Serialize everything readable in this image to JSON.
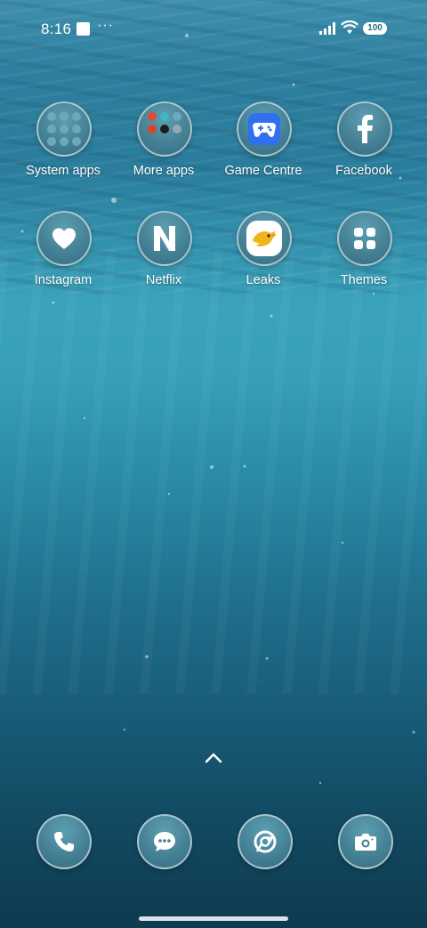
{
  "status_bar": {
    "time": "8:16",
    "notification_dots": "···",
    "battery": "100"
  },
  "apps": [
    {
      "label": "System apps",
      "icon": "system-apps-folder-icon"
    },
    {
      "label": "More apps",
      "icon": "more-apps-folder-icon"
    },
    {
      "label": "Game Centre",
      "icon": "game-centre-icon"
    },
    {
      "label": "Facebook",
      "icon": "facebook-icon"
    },
    {
      "label": "Instagram",
      "icon": "instagram-icon"
    },
    {
      "label": "Netflix",
      "icon": "netflix-icon"
    },
    {
      "label": "Leaks",
      "icon": "leaks-icon"
    },
    {
      "label": "Themes",
      "icon": "themes-icon"
    }
  ],
  "dock": [
    {
      "icon": "phone-icon"
    },
    {
      "icon": "messages-icon"
    },
    {
      "icon": "chrome-icon"
    },
    {
      "icon": "camera-icon"
    }
  ],
  "colors": {
    "icon_fill": "#437f93",
    "icon_border": "#ffffff",
    "game_centre_tile": "#2f6ff0",
    "leaks_bird": "#f2b41c"
  }
}
